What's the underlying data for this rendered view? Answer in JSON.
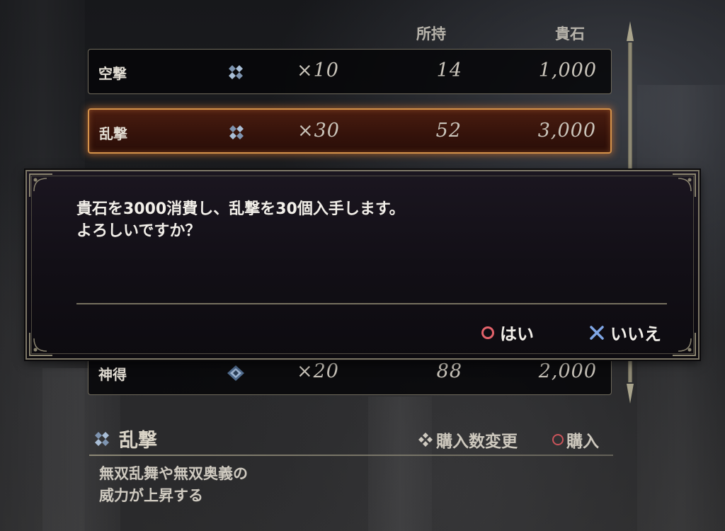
{
  "header": {
    "owned_label": "所持",
    "price_label": "貴石"
  },
  "items": [
    {
      "name": "空撃",
      "icon": "gem-cluster-icon",
      "qty": "×10",
      "owned": "14",
      "price": "1,000"
    },
    {
      "name": "乱撃",
      "icon": "gem-cluster-icon",
      "qty": "×30",
      "owned": "52",
      "price": "3,000",
      "selected": true
    },
    {
      "name": "神得",
      "icon": "diamond-gem-icon",
      "qty": "×20",
      "owned": "88",
      "price": "2,000"
    }
  ],
  "dialog": {
    "message": "貴石を3000消費し、乱撃を30個入手します。\nよろしいですか？",
    "yes_label": "はい",
    "no_label": "いいえ"
  },
  "detail": {
    "title": "乱撃",
    "description": "無双乱舞や無双奥義の\n威力が上昇する",
    "hint_change_qty": "購入数変更",
    "hint_buy": "購入"
  },
  "colors": {
    "accent_select": "#d4924a",
    "circle_button": "#e2626a",
    "cross_button": "#7fa6e6"
  }
}
